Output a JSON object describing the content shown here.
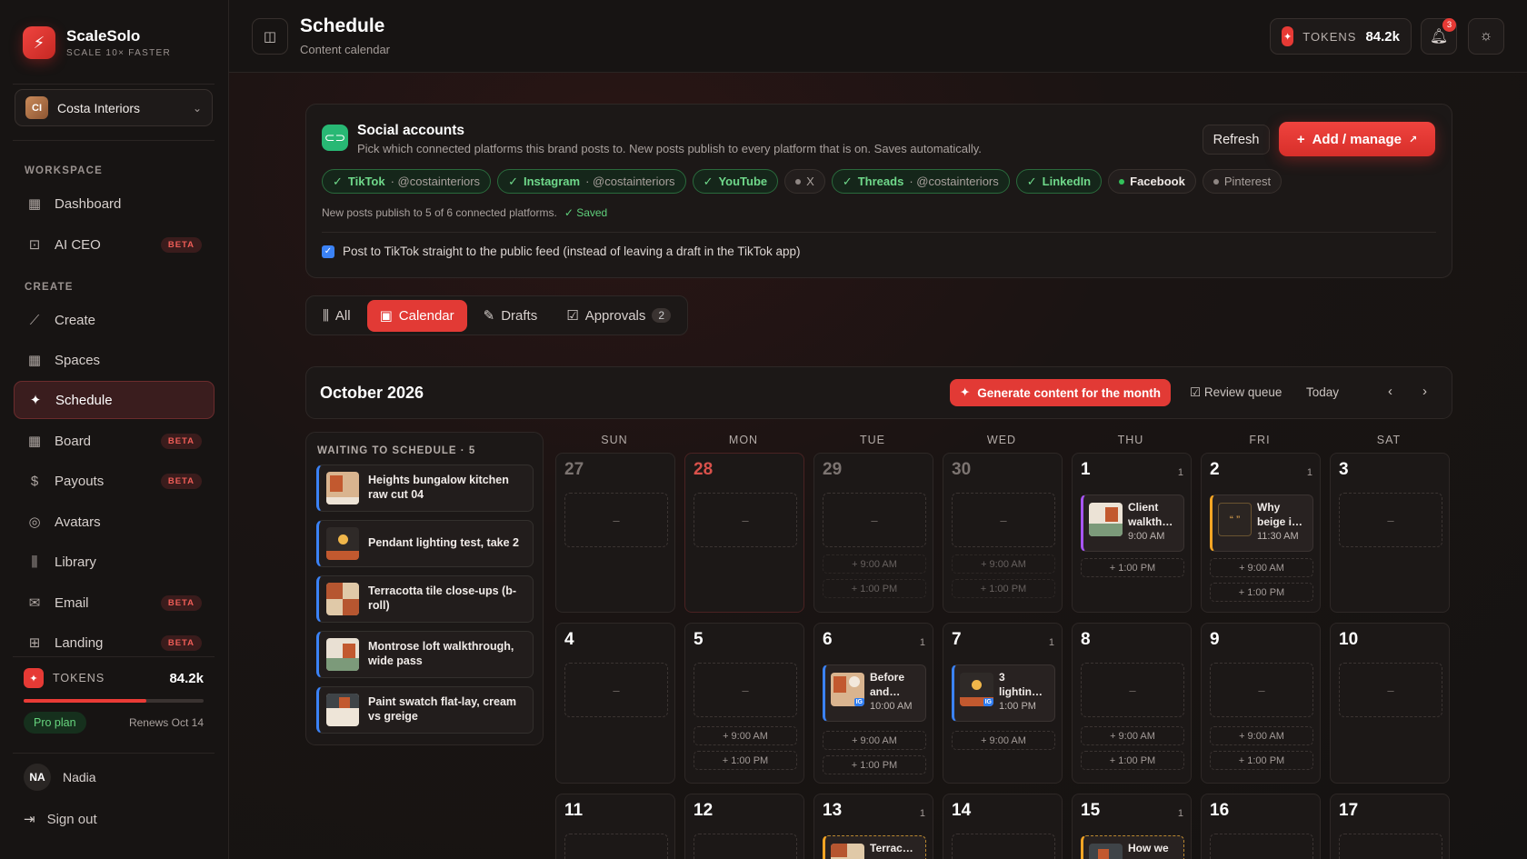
{
  "brand": {
    "name": "ScaleSolo",
    "tagline": "SCALE 10× FASTER"
  },
  "workspace": {
    "initials": "CI",
    "name": "Costa Interiors"
  },
  "sidebar": {
    "workspace_label": "WORKSPACE",
    "create_label": "CREATE",
    "items": [
      {
        "label": "Dashboard",
        "icon": "grid-icon",
        "beta": ""
      },
      {
        "label": "AI CEO",
        "icon": "robot-icon",
        "beta": "BETA"
      },
      {
        "label": "Create",
        "icon": "wand-icon",
        "beta": ""
      },
      {
        "label": "Spaces",
        "icon": "grid-icon",
        "beta": ""
      },
      {
        "label": "Schedule",
        "icon": "sparkle-icon",
        "beta": ""
      },
      {
        "label": "Board",
        "icon": "grid-icon",
        "beta": "BETA"
      },
      {
        "label": "Payouts",
        "icon": "dollar-icon",
        "beta": "BETA"
      },
      {
        "label": "Avatars",
        "icon": "user-circle-icon",
        "beta": ""
      },
      {
        "label": "Library",
        "icon": "library-icon",
        "beta": ""
      },
      {
        "label": "Email",
        "icon": "mail-icon",
        "beta": "BETA"
      },
      {
        "label": "Landing",
        "icon": "layout-icon",
        "beta": "BETA"
      }
    ],
    "tokens_label": "TOKENS",
    "tokens_value": "84.2k",
    "token_usage": 0.68,
    "plan": "Pro plan",
    "renews": "Renews Oct 14",
    "user_initials": "NA",
    "user_name": "Nadia",
    "signout": "Sign out"
  },
  "header": {
    "title": "Schedule",
    "subtitle": "Content calendar",
    "tokens_label": "TOKENS",
    "tokens_value": "84.2k",
    "notif_count": "3"
  },
  "social": {
    "title": "Social accounts",
    "desc": "Pick which connected platforms this brand posts to. New posts publish to every platform that is on. Saves automatically.",
    "refresh": "Refresh",
    "add": "Add / manage",
    "note": "New posts publish to 5 of 6 connected platforms.",
    "saved": "Saved",
    "tiktok_opt": "Post to TikTok straight to the public feed (instead of leaving a draft in the TikTok app)"
  },
  "tabs": {
    "all": "All",
    "calendar": "Calendar",
    "drafts": "Drafts",
    "approvals": "Approvals",
    "approvals_count": "2"
  },
  "calendar": {
    "month": "October 2026",
    "generate": "Generate content for the month",
    "review": "Review queue",
    "today": "Today",
    "prev": "‹",
    "next": "›",
    "dows": [
      "SUN",
      "MON",
      "TUE",
      "WED",
      "THU",
      "FRI",
      "SAT"
    ]
  },
  "queue": {
    "title": "WAITING TO SCHEDULE · 5",
    "items": [
      "Heights bungalow kitchen raw cut 04",
      "Pendant lighting test, take 2",
      "Terracotta tile close-ups (b-roll)",
      "Montrose loft walkthrough, wide pass",
      "Paint swatch flat-lay, cream vs greige"
    ]
  },
  "days": {
    "r1": [
      "27",
      "28",
      "29",
      "30",
      "1",
      "2",
      "3"
    ],
    "r2": [
      "4",
      "5",
      "6",
      "7",
      "8",
      "9",
      "10"
    ],
    "r3": [
      "11",
      "12",
      "13",
      "14",
      "15",
      "16",
      "17"
    ],
    "cnt": "1",
    "dash": "–",
    "t900": "+ 9:00 AM",
    "t100": "+ 1:00 PM",
    "p_oct1": {
      "title": "Client walkth…",
      "time": "9:00 AM"
    },
    "p_oct2": {
      "title": "Why beige i…",
      "time": "11:30 AM"
    },
    "p_oct6": {
      "title": "Before and…",
      "time": "10:00 AM"
    },
    "p_oct7": {
      "title": "3 lightin…",
      "time": "1:00 PM"
    },
    "p_oct13": {
      "title": "Terrac…"
    },
    "p_oct15": {
      "title": "How we"
    },
    "ig": "IG",
    "quote": "“ ”"
  }
}
